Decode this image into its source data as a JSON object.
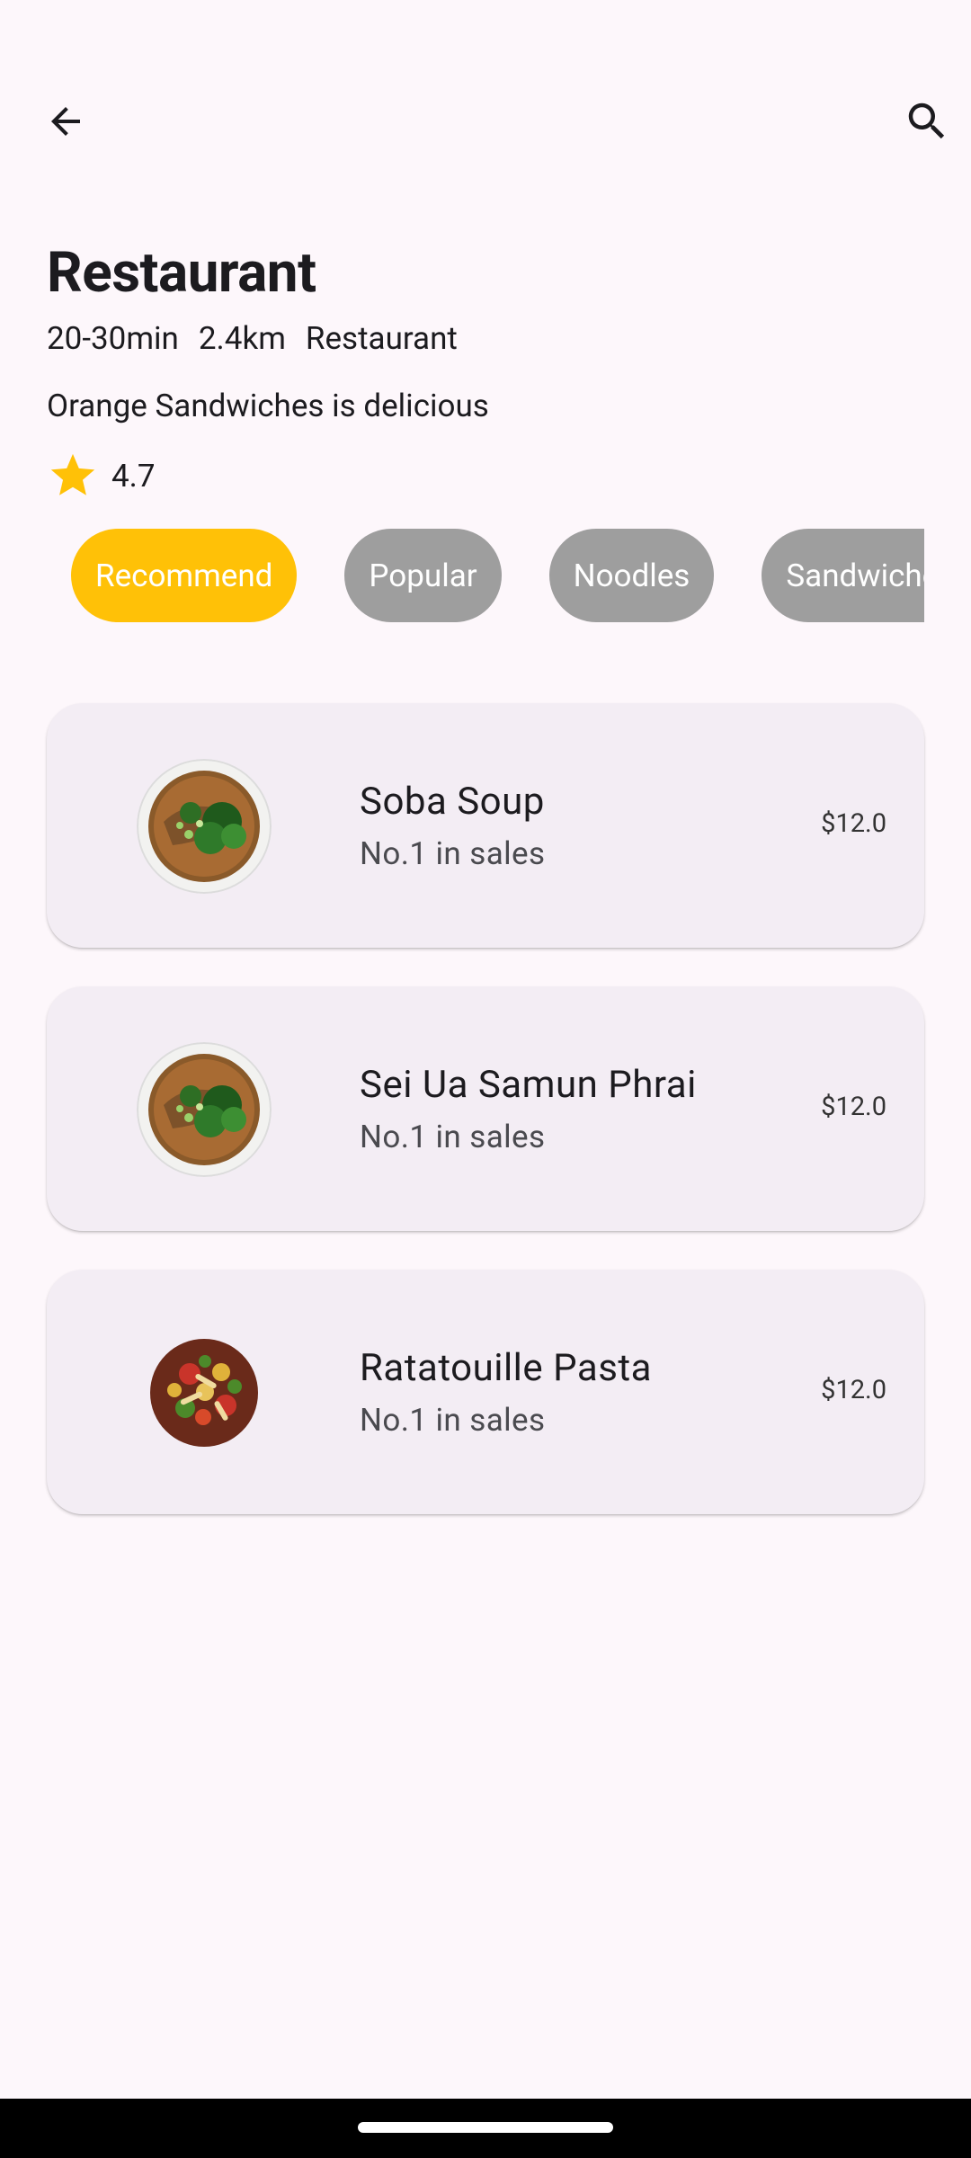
{
  "header": {
    "title": "Restaurant",
    "meta": {
      "time": "20-30min",
      "distance": "2.4km",
      "category": "Restaurant"
    },
    "description": "Orange Sandwiches is delicious",
    "rating": "4.7"
  },
  "colors": {
    "accent": "#ffc107",
    "chip_inactive": "#9e9e9e",
    "card_bg": "#f3edf4",
    "page_bg": "#fdf7fb"
  },
  "chips": [
    {
      "label": "Recommend",
      "active": true
    },
    {
      "label": "Popular",
      "active": false
    },
    {
      "label": "Noodles",
      "active": false
    },
    {
      "label": "Sandwiches",
      "active": false
    }
  ],
  "menu": [
    {
      "name": "Soba Soup",
      "subtitle": "No.1 in sales",
      "price": "$12.0",
      "image": "soup-bowl"
    },
    {
      "name": "Sei Ua Samun Phrai",
      "subtitle": "No.1 in sales",
      "price": "$12.0",
      "image": "soup-bowl"
    },
    {
      "name": "Ratatouille Pasta",
      "subtitle": "No.1 in sales",
      "price": "$12.0",
      "image": "salad-plate"
    }
  ],
  "icons": {
    "back": "arrow-back-icon",
    "search": "search-icon",
    "rating": "star-icon"
  }
}
